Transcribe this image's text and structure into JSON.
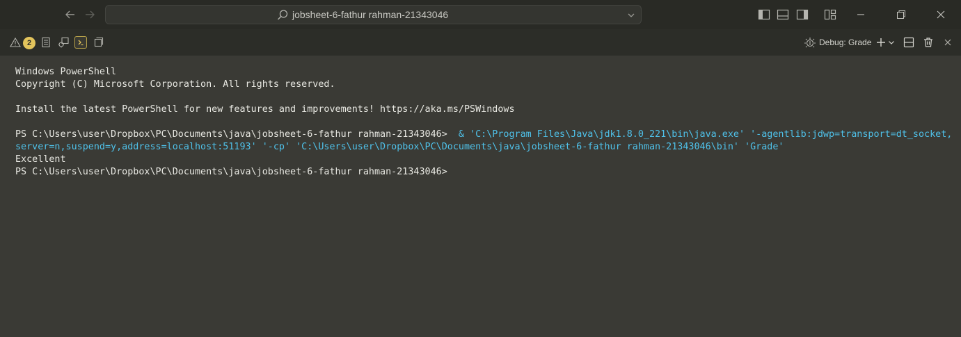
{
  "titlebar": {
    "title": "jobsheet-6-fathur rahman-21343046",
    "icons": {
      "back": "arrow-left-icon",
      "forward": "arrow-right-icon",
      "search": "search-icon",
      "chevron": "chevron-down-icon",
      "toggle_primary_sidebar": "sidebar-left-icon",
      "toggle_panel": "panel-bottom-icon",
      "toggle_secondary_sidebar": "sidebar-right-icon",
      "customize_layout": "layout-grid-icon",
      "minimize": "minimize-icon",
      "restore": "restore-icon",
      "close": "close-icon"
    }
  },
  "panel": {
    "problems_count": "2",
    "debug_label": "Debug: Grade",
    "icons": {
      "problems": "warning-icon",
      "output": "output-icon",
      "debug_console": "debug-console-icon",
      "terminal": "terminal-icon",
      "ports": "ports-icon",
      "debug": "debug-gear-icon",
      "new_terminal": "plus-icon",
      "split": "split-terminal-icon",
      "kill": "trash-icon",
      "close": "close-panel-icon"
    },
    "accent": "#e3c45c"
  },
  "terminal": {
    "lines": [
      "Windows PowerShell",
      "Copyright (C) Microsoft Corporation. All rights reserved.",
      "",
      "Install the latest PowerShell for new features and improvements! https://aka.ms/PSWindows",
      ""
    ],
    "prompt1": "PS C:\\Users\\user\\Dropbox\\PC\\Documents\\java\\jobsheet-6-fathur rahman-21343046> ",
    "command_line1": " & 'C:\\Program Files\\Java\\jdk1.8.0_221\\bin\\java.exe' '-agentlib:jdwp=transport=dt_socket,",
    "command_line2": "server=n,suspend=y,address=localhost:51193' '-cp' 'C:\\Users\\user\\Dropbox\\PC\\Documents\\java\\jobsheet-6-fathur rahman-21343046\\bin' 'Grade'",
    "output": "Excellent",
    "prompt2": "PS C:\\Users\\user\\Dropbox\\PC\\Documents\\java\\jobsheet-6-fathur rahman-21343046>",
    "command_color": "#4fc1e9"
  }
}
